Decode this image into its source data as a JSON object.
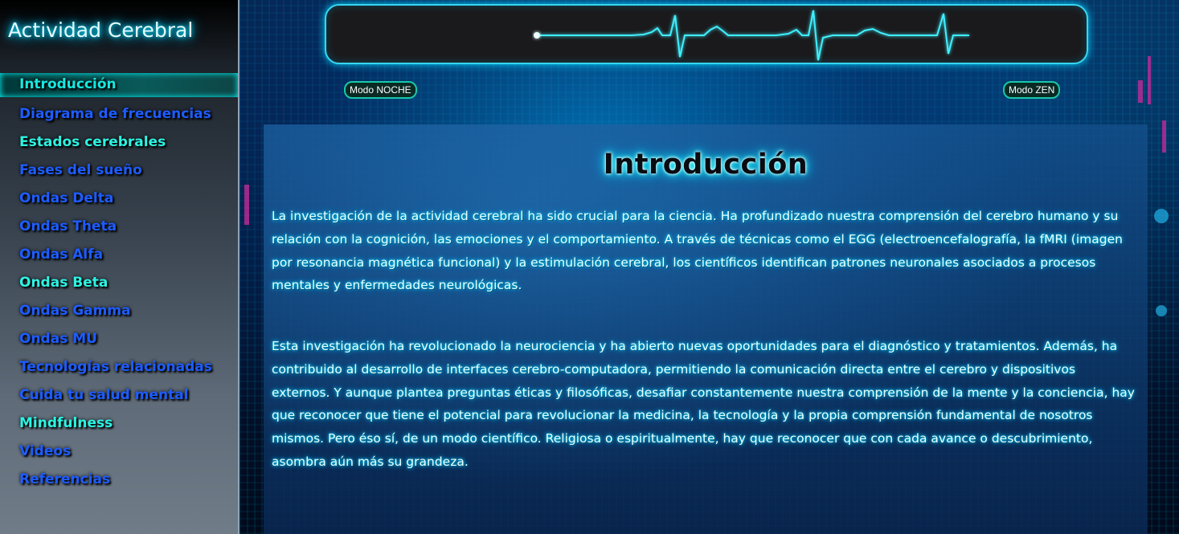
{
  "sidebar": {
    "title": "Actividad Cerebral",
    "items": [
      {
        "label": "Introducción",
        "style": "active"
      },
      {
        "label": "Diagrama de frecuencias",
        "style": "blue"
      },
      {
        "label": "Estados cerebrales",
        "style": "cyan"
      },
      {
        "label": "Fases del sueño",
        "style": "blue"
      },
      {
        "label": "Ondas Delta",
        "style": "blue"
      },
      {
        "label": "Ondas Theta",
        "style": "blue"
      },
      {
        "label": "Ondas Alfa",
        "style": "blue"
      },
      {
        "label": "Ondas Beta",
        "style": "cyan"
      },
      {
        "label": "Ondas Gamma",
        "style": "blue"
      },
      {
        "label": "Ondas MU",
        "style": "blue"
      },
      {
        "label": "Tecnologías relacionadas",
        "style": "blue"
      },
      {
        "label": "Cuida tu salud mental",
        "style": "blue"
      },
      {
        "label": "Mindfulness",
        "style": "cyan"
      },
      {
        "label": "Videos",
        "style": "blue"
      },
      {
        "label": "Referencias",
        "style": "blue"
      }
    ]
  },
  "modes": {
    "noche_label": "Modo NOCHE",
    "zen_label": "Modo ZEN"
  },
  "content": {
    "title": "Introducción",
    "paragraphs": [
      "La investigación de la actividad cerebral ha sido crucial para la ciencia. Ha profundizado nuestra comprensión del cerebro humano y su relación con la cognición, las emociones y el comportamiento. A través de técnicas como el EGG (electroencefalografía, la fMRI (imagen por resonancia magnética funcional) y la estimulación cerebral, los científicos identifican patrones neuronales asociados a procesos mentales y enfermedades neurológicas.",
      "Esta investigación ha revolucionado la neurociencia y ha abierto nuevas oportunidades para el diagnóstico y tratamientos. Además, ha contribuido al desarrollo de interfaces cerebro-computadora, permitiendo la comunicación directa entre el cerebro y dispositivos externos. Y aunque plantea preguntas éticas y filosóficas, desafiar constantemente nuestra comprensión de la mente y la conciencia, hay que reconocer que tiene el potencial para revolucionar la medicina, la tecnología y la propia comprensión fundamental de nosotros mismos. Pero éso sí, de un modo científico. Religiosa o espiritualmente, hay que reconocer que con cada avance o descubrimiento, asombra aún más su grandeza."
    ]
  },
  "colors": {
    "accent_cyan": "#2df3e3",
    "nav_blue": "#1e5cff",
    "monitor_border": "#38d6f0",
    "mode_border": "#18c8a8"
  },
  "icons": {
    "ekg": "ekg-heartbeat-line"
  }
}
